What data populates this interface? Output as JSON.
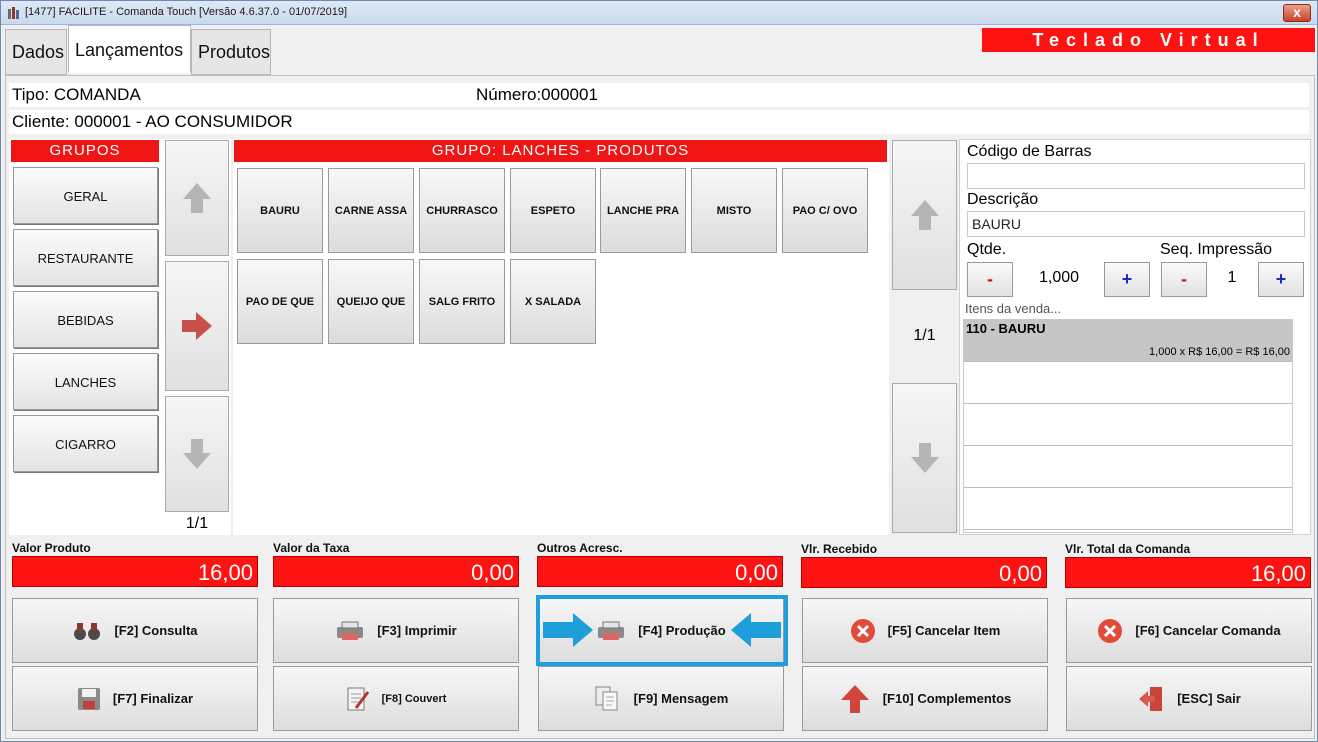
{
  "window": {
    "title": "[1477] FACILITE - Comanda Touch [Versão 4.6.37.0 - 01/07/2019]",
    "close_label": "x"
  },
  "tabs": [
    {
      "label": "Dados"
    },
    {
      "label": "Lançamentos"
    },
    {
      "label": "Produtos"
    }
  ],
  "virtual_keyboard_label": "Teclado Virtual",
  "info": {
    "tipo": "Tipo: COMANDA",
    "numero": "Número:000001",
    "cliente": "Cliente: 000001 - AO CONSUMIDOR"
  },
  "grupos": {
    "header": "GRUPOS",
    "items": [
      "GERAL",
      "RESTAURANTE",
      "BEBIDAS",
      "LANCHES",
      "CIGARRO"
    ],
    "pager": "1/1"
  },
  "produtos": {
    "header": "GRUPO: LANCHES - PRODUTOS",
    "items": [
      "BAURU",
      "CARNE ASSA",
      "CHURRASCO",
      "ESPETO",
      "LANCHE PRA",
      "MISTO",
      "PAO C/ OVO",
      "PAO DE QUE",
      "QUEIJO QUE",
      "SALG FRITO",
      "X SALADA"
    ],
    "pager": "1/1"
  },
  "detail": {
    "codigo_label": "Código de Barras",
    "codigo_value": "",
    "descricao_label": "Descrição",
    "descricao_value": "BAURU",
    "qtde_label": "Qtde.",
    "qtde_value": "1,000",
    "seq_label": "Seq. Impressão",
    "seq_value": "1",
    "minus": "-",
    "plus": "+",
    "itens_label": "Itens da venda...",
    "itens": [
      {
        "name": "110 - BAURU",
        "detail": "1,000 x R$ 16,00 = R$ 16,00"
      }
    ]
  },
  "totals": [
    {
      "label": "Valor Produto",
      "value": "16,00"
    },
    {
      "label": "Valor da Taxa",
      "value": "0,00"
    },
    {
      "label": "Outros Acresc.",
      "value": "0,00"
    },
    {
      "label": "Vlr. Recebido",
      "value": "0,00"
    },
    {
      "label": "Vlr. Total da Comanda",
      "value": "16,00"
    }
  ],
  "actions": [
    "[F2] Consulta",
    "[F3] Imprimir",
    "[F4] Produção",
    "[F5] Cancelar Item",
    "[F6] Cancelar Comanda",
    "[F7] Finalizar",
    "[F8] Couvert",
    "[F9] Mensagem",
    "[F10] Complementos",
    "[ESC] Sair"
  ],
  "colors": {
    "accent_red": "#ff1212",
    "highlight_blue": "#1e9fdb"
  }
}
